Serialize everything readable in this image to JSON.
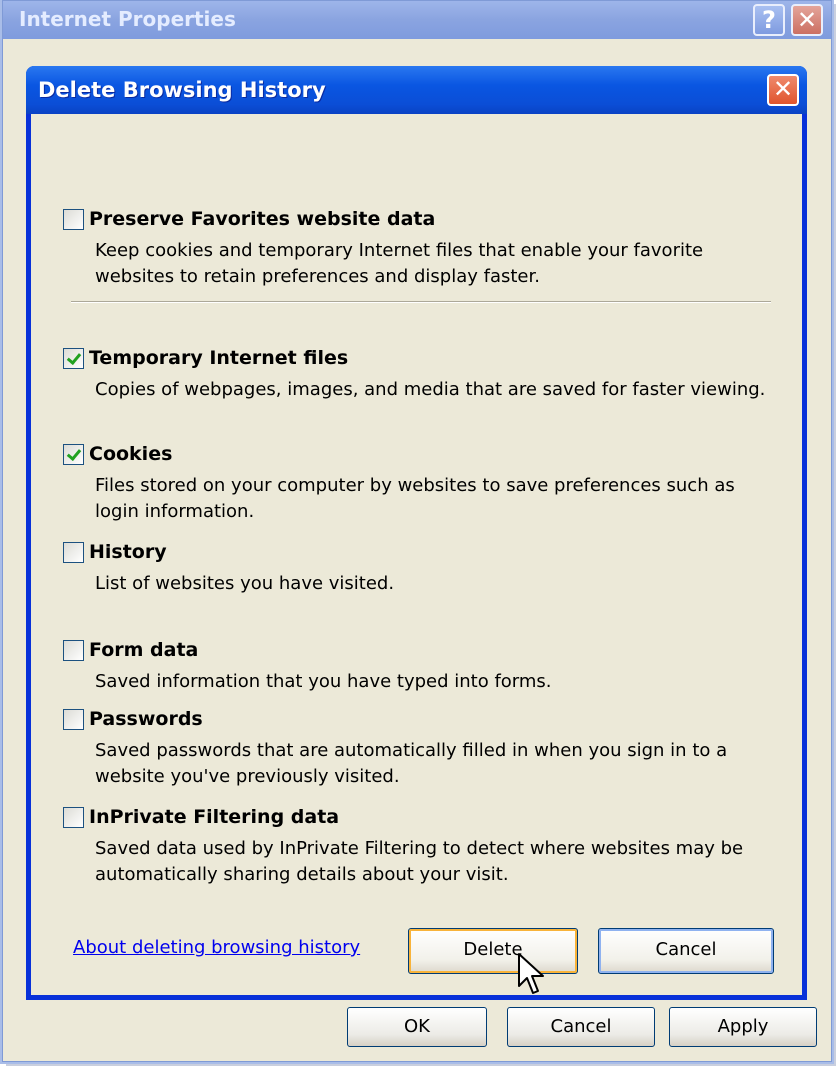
{
  "outer_window": {
    "title": "Internet Properties",
    "help_glyph": "?",
    "close_glyph": "✕",
    "buttons": {
      "ok": "OK",
      "cancel": "Cancel",
      "apply": "Apply"
    }
  },
  "dialog": {
    "title": "Delete Browsing History",
    "close_glyph": "✕",
    "options": [
      {
        "label": "Preserve Favorites website data",
        "description": "Keep cookies and temporary Internet files that enable your favorite websites to retain preferences and display faster.",
        "checked": false
      },
      {
        "label": "Temporary Internet files",
        "description": "Copies of webpages, images, and media that are saved for faster viewing.",
        "checked": true
      },
      {
        "label": "Cookies",
        "description": "Files stored on your computer by websites to save preferences such as login information.",
        "checked": true
      },
      {
        "label": "History",
        "description": "List of websites you have visited.",
        "checked": false
      },
      {
        "label": "Form data",
        "description": "Saved information that you have typed into forms.",
        "checked": false
      },
      {
        "label": "Passwords",
        "description": "Saved passwords that are automatically filled in when you sign in to a website you've previously visited.",
        "checked": false
      },
      {
        "label": "InPrivate Filtering data",
        "description": "Saved data used by InPrivate Filtering to detect where websites may be automatically sharing details about your visit.",
        "checked": false
      }
    ],
    "help_link": "About deleting browsing history",
    "buttons": {
      "delete": "Delete",
      "cancel": "Cancel"
    }
  },
  "icons": {
    "cursor": "mouse-pointer-icon"
  }
}
